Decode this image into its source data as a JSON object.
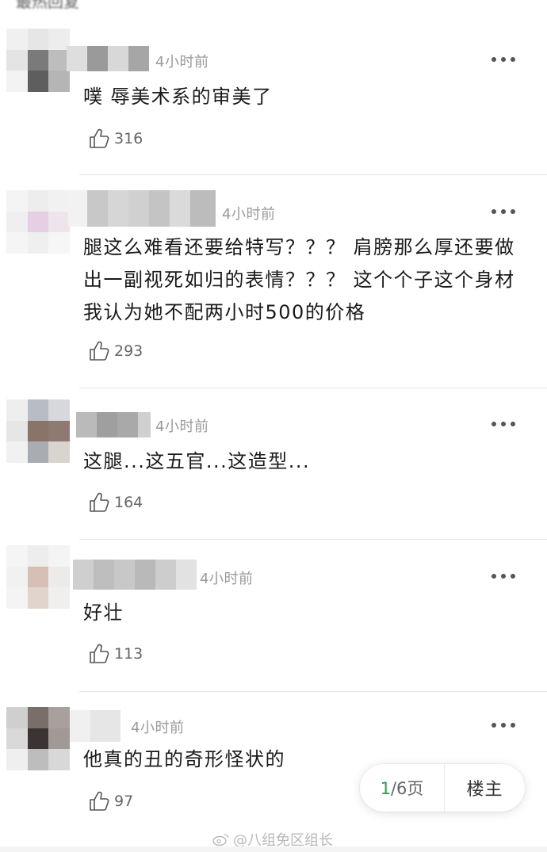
{
  "header": {
    "cut_text": "最热回复"
  },
  "comments": [
    {
      "time": "4小时前",
      "text": "噗 辱美术系的审美了",
      "likes": "316"
    },
    {
      "time": "4小时前",
      "text": "腿这么难看还要给特写？？？ 肩膀那么厚还要做出一副视死如归的表情？？？ 这个个子这个身材我认为她不配两小时500的价格",
      "likes": "293"
    },
    {
      "time": "4小时前",
      "text": "这腿...这五官...这造型...",
      "likes": "164"
    },
    {
      "time": "4小时前",
      "text": "好壮",
      "likes": "113"
    },
    {
      "time": "4小时前",
      "text": "他真的丑的奇形怪状的",
      "likes": "97"
    }
  ],
  "pager": {
    "current": "1",
    "total_suffix": "/6页",
    "op_label": "楼主",
    "accent": "#2e9d4f"
  },
  "watermark": {
    "text": "@八组免区组长"
  },
  "icons": {
    "like": "thumb-up-icon",
    "more": "more-dots-icon",
    "weibo": "weibo-logo-icon"
  }
}
